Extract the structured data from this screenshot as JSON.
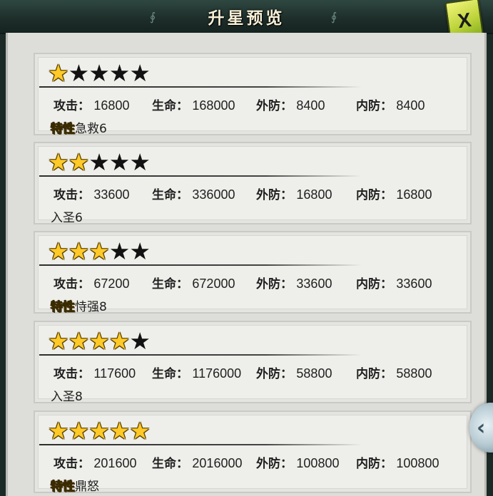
{
  "header": {
    "title": "升星预览",
    "close_label": "X",
    "deco_left": "∮",
    "deco_right": "∮"
  },
  "icons": {
    "star_filled": "★",
    "star_empty": "★",
    "side_arrow": "‹"
  },
  "colors": {
    "star_gold": "#ffc928",
    "star_black": "#121212",
    "close_green": "#bcd33a"
  },
  "labels": {
    "attack": "攻击：",
    "life": "生命：",
    "outer_def": "外防：",
    "inner_def": "内防：",
    "trait_tag": "特性"
  },
  "levels": [
    {
      "stars": 1,
      "attack": "16800",
      "life": "168000",
      "outer_def": "8400",
      "inner_def": "8400",
      "has_trait_tag": true,
      "trait_text": "急救6"
    },
    {
      "stars": 2,
      "attack": "33600",
      "life": "336000",
      "outer_def": "16800",
      "inner_def": "16800",
      "has_trait_tag": false,
      "trait_text": "入圣6"
    },
    {
      "stars": 3,
      "attack": "67200",
      "life": "672000",
      "outer_def": "33600",
      "inner_def": "33600",
      "has_trait_tag": true,
      "trait_text": "恃强8"
    },
    {
      "stars": 4,
      "attack": "117600",
      "life": "1176000",
      "outer_def": "58800",
      "inner_def": "58800",
      "has_trait_tag": false,
      "trait_text": "入圣8"
    },
    {
      "stars": 5,
      "attack": "201600",
      "life": "2016000",
      "outer_def": "100800",
      "inner_def": "100800",
      "has_trait_tag": true,
      "trait_text": "鼎怒"
    }
  ]
}
